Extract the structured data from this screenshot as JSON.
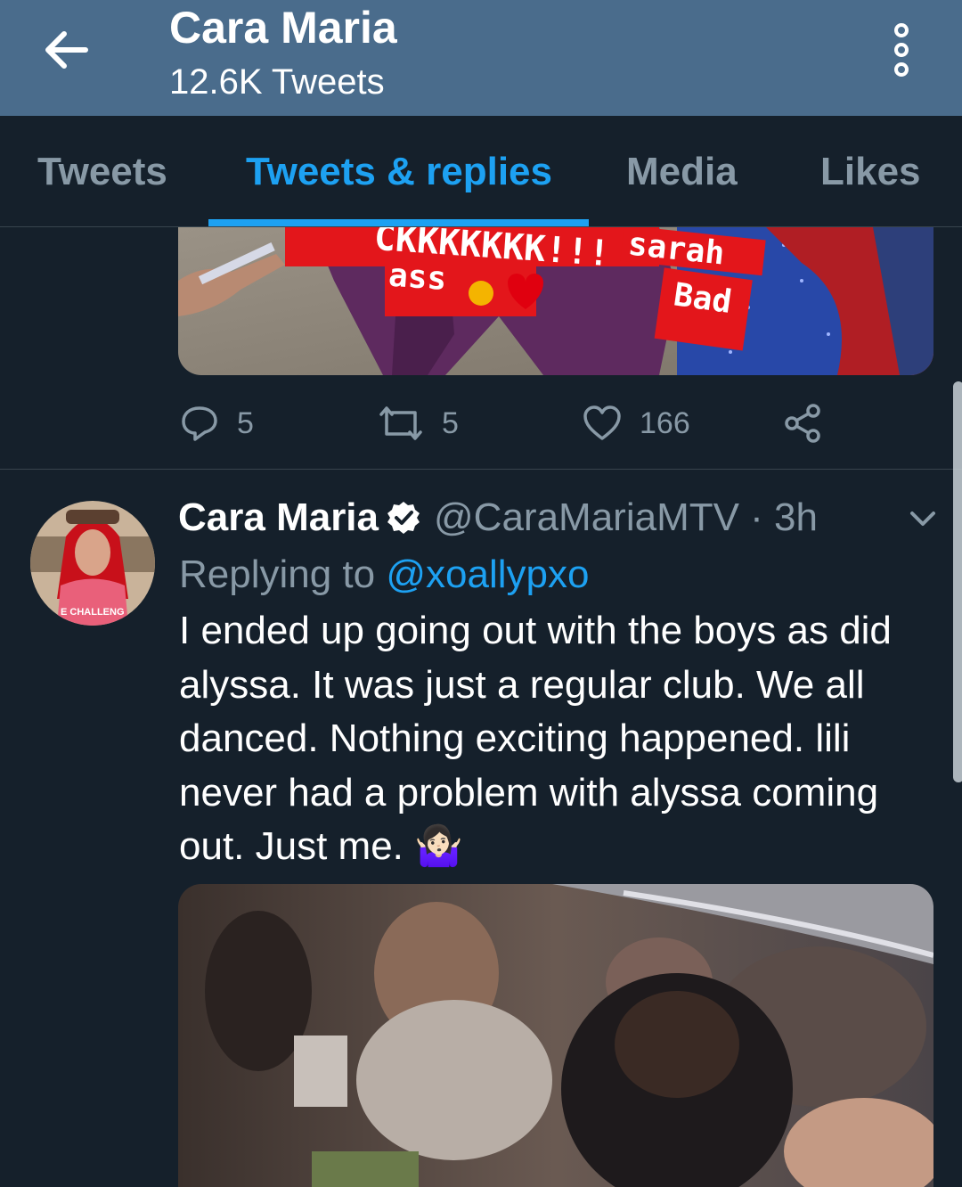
{
  "header": {
    "title": "Cara Maria",
    "subtitle": "12.6K Tweets",
    "back_icon": "arrow-left-icon",
    "more_icon": "more-vertical-icon"
  },
  "tabs": [
    {
      "label": "Tweets",
      "active": false
    },
    {
      "label": "Tweets & replies",
      "active": true
    },
    {
      "label": "Media",
      "active": false
    },
    {
      "label": "Likes",
      "active": false
    }
  ],
  "tweet1": {
    "image_text": {
      "top": "CKKKKKKK!!!",
      "sarah": "sarah",
      "ass": "ass",
      "bad": "Bad"
    },
    "actions": {
      "reply_count": "5",
      "retweet_count": "5",
      "like_count": "166"
    }
  },
  "tweet2": {
    "author_name": "Cara Maria",
    "handle": "@CaraMariaMTV · 3h",
    "replying_prefix": "Replying to",
    "replying_to": "@xoallypxo",
    "text": "I ended up going out with the boys as did alyssa. It was just a regular club. We all danced. Nothing exciting happened. lili never had a problem with alyssa coming out. Just me. 🤷🏻‍♀️",
    "avatar_shirt_text": "E CHALLENG"
  },
  "colors": {
    "app_bar": "#4a6c8c",
    "background": "#15202b",
    "accent": "#1da1f2",
    "muted_text": "#8899a6",
    "divider": "#38444d"
  }
}
